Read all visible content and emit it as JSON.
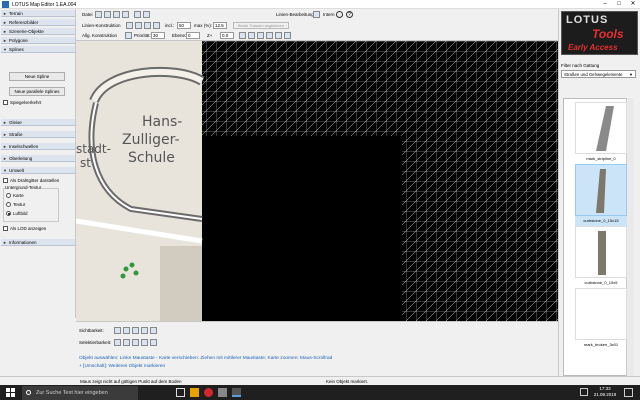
{
  "window": {
    "title": "LOTUS Map Editor 1.EA.004"
  },
  "sidebar": {
    "sections": [
      "Terrain",
      "Referenzbilder",
      "Szenerie-Objekte",
      "Polygone",
      "Splines",
      "Gleise",
      "Straße",
      "Inselschwellen",
      "Oberleitung",
      "Umwelt",
      "Informationen"
    ],
    "splines": {
      "new_spline": "Neue Spline",
      "new_parallel_spline": "Neue parallele Splines",
      "mirrored": "Spiegelverkehrt"
    },
    "umwelt": {
      "wireframe": "Als Drahtgitter darstellen",
      "underground_label": "Untergrund-Textur",
      "opt_map": "Karte",
      "opt_texture": "Textur",
      "opt_aerial": "Luftbild",
      "lod": "Als LOD anzeigen"
    }
  },
  "toolbar": {
    "file_label": "Datei",
    "line_edit": "Linien-Bearbeitung",
    "intern": "Intern",
    "line_construction": "Linien-Konstruktion",
    "incl_label": "incl.:",
    "incl_value": "50",
    "max_label": "max (%):",
    "max_value": "12.5",
    "merge_btn": "Beide Trassen angleichen",
    "general_construction": "Allg. Konstruktion",
    "priority_label": "Priorität:",
    "priority_value": "30",
    "plane_label": "Ebene:",
    "plane_value": "0",
    "z_label": "Z+",
    "z_value": "0.0"
  },
  "map": {
    "labels": [
      "Hans-",
      "Zulliger-",
      "Schule",
      "stadt-",
      "st"
    ],
    "grid_color": "#d8d8d8"
  },
  "bottom": {
    "visibility": "Sichtbarkeit:",
    "selectable": "Selektierbarkeit:",
    "hint1": "Objekt auswählen: Linke Maustaste - Karte verschieben: Ziehen mit mittlerer Maustaste; Karte zoomen: Maus-Scrollrad",
    "hint2": "+ [Umschalt]: Weiteres Objekt markieren"
  },
  "right": {
    "logo_top": "LOTUS",
    "logo_mid": "Tools",
    "logo_bottom": "Early Access",
    "filter_label": "Filter nach Gattung",
    "filter_value": "Straßen und Gehwegelemente",
    "items": [
      "mark_stripline_0",
      "curbstone_0_15x15",
      "curbstone_0_15x5",
      "mark_broken_3x01"
    ]
  },
  "status": {
    "left": "Maus zeigt nicht auf gültigen Punkt auf dem Boden",
    "right": "Kein Objekt markiert."
  },
  "taskbar": {
    "search_placeholder": "Zur Suche Text hier eingeben",
    "time": "17:33",
    "date": "21.09.2018"
  }
}
